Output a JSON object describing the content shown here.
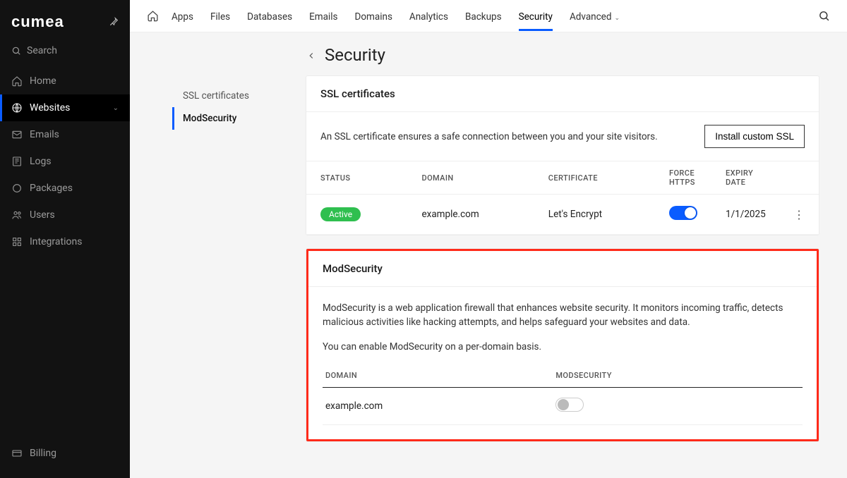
{
  "brand": "ᴄumea",
  "sidebar": {
    "search_placeholder": "Search",
    "items": [
      {
        "label": "Home",
        "icon": "home"
      },
      {
        "label": "Websites",
        "icon": "globe",
        "active": true,
        "expandable": true
      },
      {
        "label": "Emails",
        "icon": "mail"
      },
      {
        "label": "Logs",
        "icon": "logs"
      },
      {
        "label": "Packages",
        "icon": "circle"
      },
      {
        "label": "Users",
        "icon": "users"
      },
      {
        "label": "Integrations",
        "icon": "grid"
      }
    ],
    "bottom": {
      "label": "Billing",
      "icon": "card"
    }
  },
  "topnav": {
    "items": [
      {
        "label": "Apps"
      },
      {
        "label": "Files"
      },
      {
        "label": "Databases"
      },
      {
        "label": "Emails"
      },
      {
        "label": "Domains"
      },
      {
        "label": "Analytics"
      },
      {
        "label": "Backups"
      },
      {
        "label": "Security",
        "active": true
      },
      {
        "label": "Advanced",
        "dropdown": true
      }
    ]
  },
  "subnav": {
    "items": [
      {
        "label": "SSL certificates"
      },
      {
        "label": "ModSecurity",
        "active": true
      }
    ]
  },
  "page": {
    "title": "Security",
    "ssl": {
      "heading": "SSL certificates",
      "description": "An SSL certificate ensures a safe connection between you and your site visitors.",
      "install_button": "Install custom SSL",
      "columns": {
        "status": "STATUS",
        "domain": "DOMAIN",
        "certificate": "CERTIFICATE",
        "force_https": "FORCE HTTPS",
        "expiry": "EXPIRY DATE"
      },
      "rows": [
        {
          "status": "Active",
          "domain": "example.com",
          "certificate": "Let's Encrypt",
          "force_https": true,
          "expiry": "1/1/2025"
        }
      ]
    },
    "modsec": {
      "heading": "ModSecurity",
      "desc1": "ModSecurity is a web application firewall that enhances website security. It monitors incoming traffic, detects malicious activities like hacking attempts, and helps safeguard your websites and data.",
      "desc2": "You can enable ModSecurity on a per-domain basis.",
      "columns": {
        "domain": "DOMAIN",
        "modsecurity": "MODSECURITY"
      },
      "rows": [
        {
          "domain": "example.com",
          "enabled": false
        }
      ]
    }
  }
}
